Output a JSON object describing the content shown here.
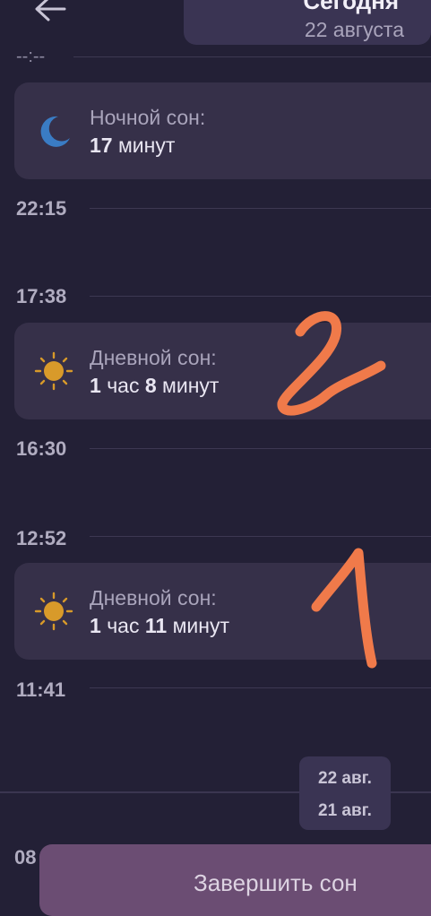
{
  "header": {
    "back_icon": "arrow-left-icon",
    "date_title": "Сегодня",
    "date_subtitle": "22 августа"
  },
  "timeline": {
    "top_time": "--:--",
    "times": [
      "22:15",
      "17:38",
      "16:30",
      "12:52",
      "11:41"
    ],
    "partial_time": "08"
  },
  "sleep_entries": [
    {
      "type": "night",
      "icon": "moon-icon",
      "label": "Ночной сон:",
      "value_num1": "17",
      "value_unit1": "минут",
      "value_num2": "",
      "value_unit2": ""
    },
    {
      "type": "day",
      "icon": "sun-icon",
      "label": "Дневной сон:",
      "value_num1": "1",
      "value_unit1": "час",
      "value_num2": "8",
      "value_unit2": "минут"
    },
    {
      "type": "day",
      "icon": "sun-icon",
      "label": "Дневной сон:",
      "value_num1": "1",
      "value_unit1": "час",
      "value_num2": "11",
      "value_unit2": "минут"
    }
  ],
  "day_separator": {
    "top": "22 авг.",
    "bottom": "21 авг."
  },
  "actions": {
    "finish_sleep": "Завершить сон"
  },
  "annotations": {
    "first": "1",
    "second": "2",
    "color": "#f07a4a"
  },
  "colors": {
    "background": "#232036",
    "card": "#363049",
    "moon": "#3a7cc4",
    "sun": "#d89a2a",
    "button": "#6b4d73"
  }
}
